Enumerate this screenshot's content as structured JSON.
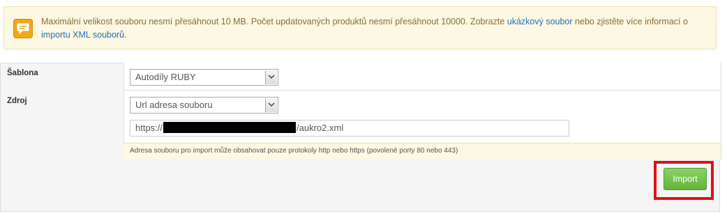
{
  "notice": {
    "text_before_link1": "Maximální velikost souboru nesmí přesáhnout 10 MB. Počet updatovaných produktů nesmí přesáhnout 10000. Zobrazte ",
    "link1": "ukázkový soubor",
    "text_between": " nebo zjistěte více informací o ",
    "link2": "importu XML souborů",
    "text_after": "."
  },
  "form": {
    "template_label": "Šablona",
    "template_value": "Autodíly RUBY",
    "source_label": "Zdroj",
    "source_value": "Url adresa souboru",
    "url_prefix": "https://",
    "url_suffix": "/aukro2.xml",
    "hint": "Adresa souboru pro import může obsahovat pouze protokoly http nebo https (povolené porty 80 nebo 443)"
  },
  "actions": {
    "import_label": "Import"
  },
  "colors": {
    "highlight": "#e0101c",
    "import_button": "#6cbf44",
    "notice_bg": "#fcf8e3"
  }
}
